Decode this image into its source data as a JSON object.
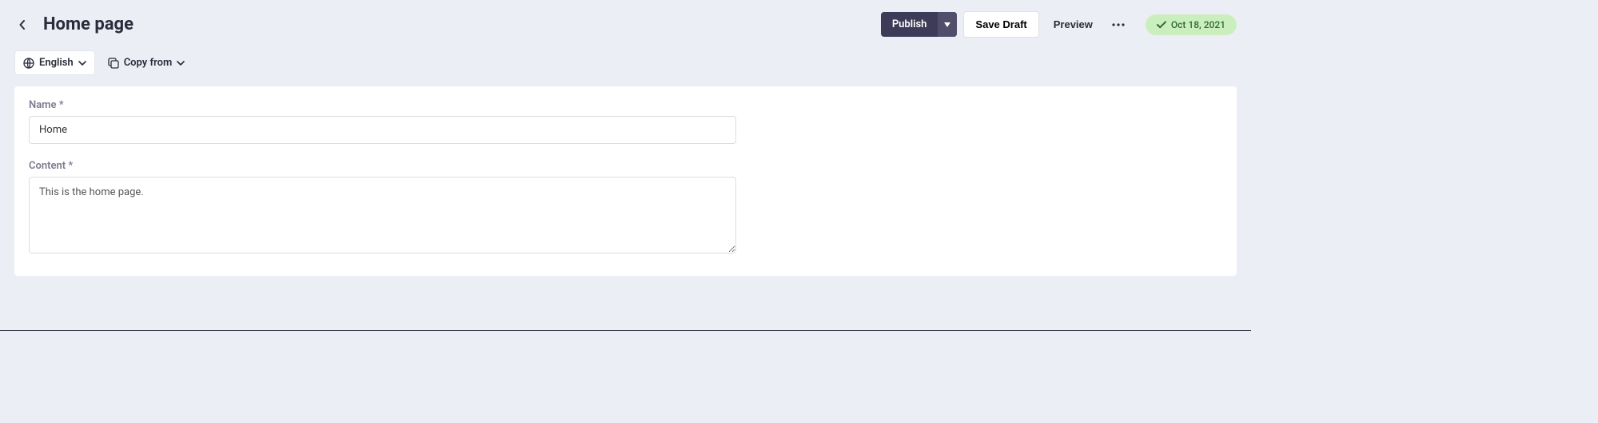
{
  "header": {
    "title": "Home page",
    "publish_label": "Publish",
    "save_draft_label": "Save Draft",
    "preview_label": "Preview",
    "status_date": "Oct 18, 2021"
  },
  "toolbar": {
    "language_label": "English",
    "copy_from_label": "Copy from"
  },
  "form": {
    "name_label": "Name *",
    "name_value": "Home",
    "content_label": "Content *",
    "content_value": "This is the home page."
  }
}
